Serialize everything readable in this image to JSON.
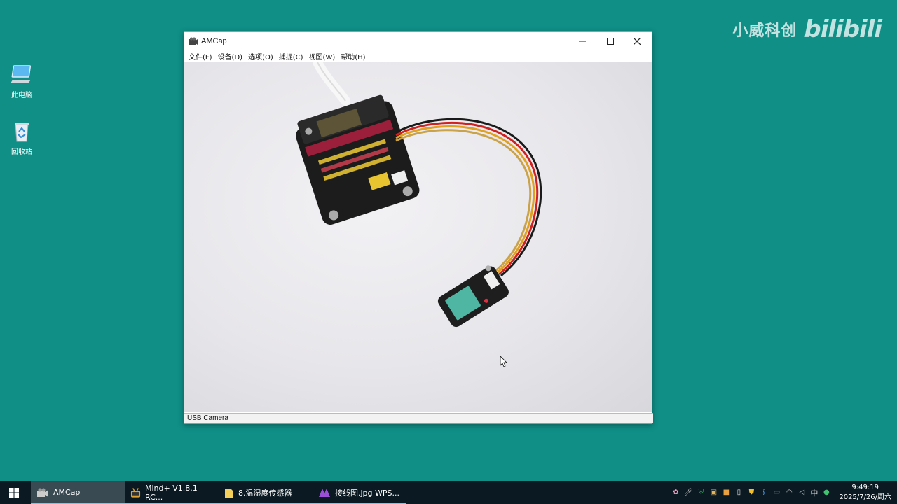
{
  "desktop": {
    "icons": [
      {
        "label": "此电脑"
      },
      {
        "label": "回收站"
      }
    ]
  },
  "watermark": {
    "text": "小威科创",
    "logo": "bilibili"
  },
  "window": {
    "title": "AMCap",
    "menu": [
      "文件(F)",
      "设备(D)",
      "选项(O)",
      "捕捉(C)",
      "视图(W)",
      "帮助(H)"
    ],
    "status": "USB Camera"
  },
  "taskbar": {
    "apps": [
      {
        "label": "AMCap",
        "icon": "camera-icon"
      },
      {
        "label": "Mind+ V1.8.1 RC...",
        "icon": "mind-plus-icon"
      },
      {
        "label": "8.温湿度传感器",
        "icon": "folder-icon"
      },
      {
        "label": "接线图.jpg  WPS...",
        "icon": "wps-icon"
      }
    ],
    "ime": "中",
    "time": "9:49:19",
    "date": "2025/7/26/周六"
  },
  "colors": {
    "desktop": "#0f8f86",
    "taskbar": "#0b1a22",
    "active_app": "#3a4a53",
    "underline": "#7cc0ee"
  }
}
